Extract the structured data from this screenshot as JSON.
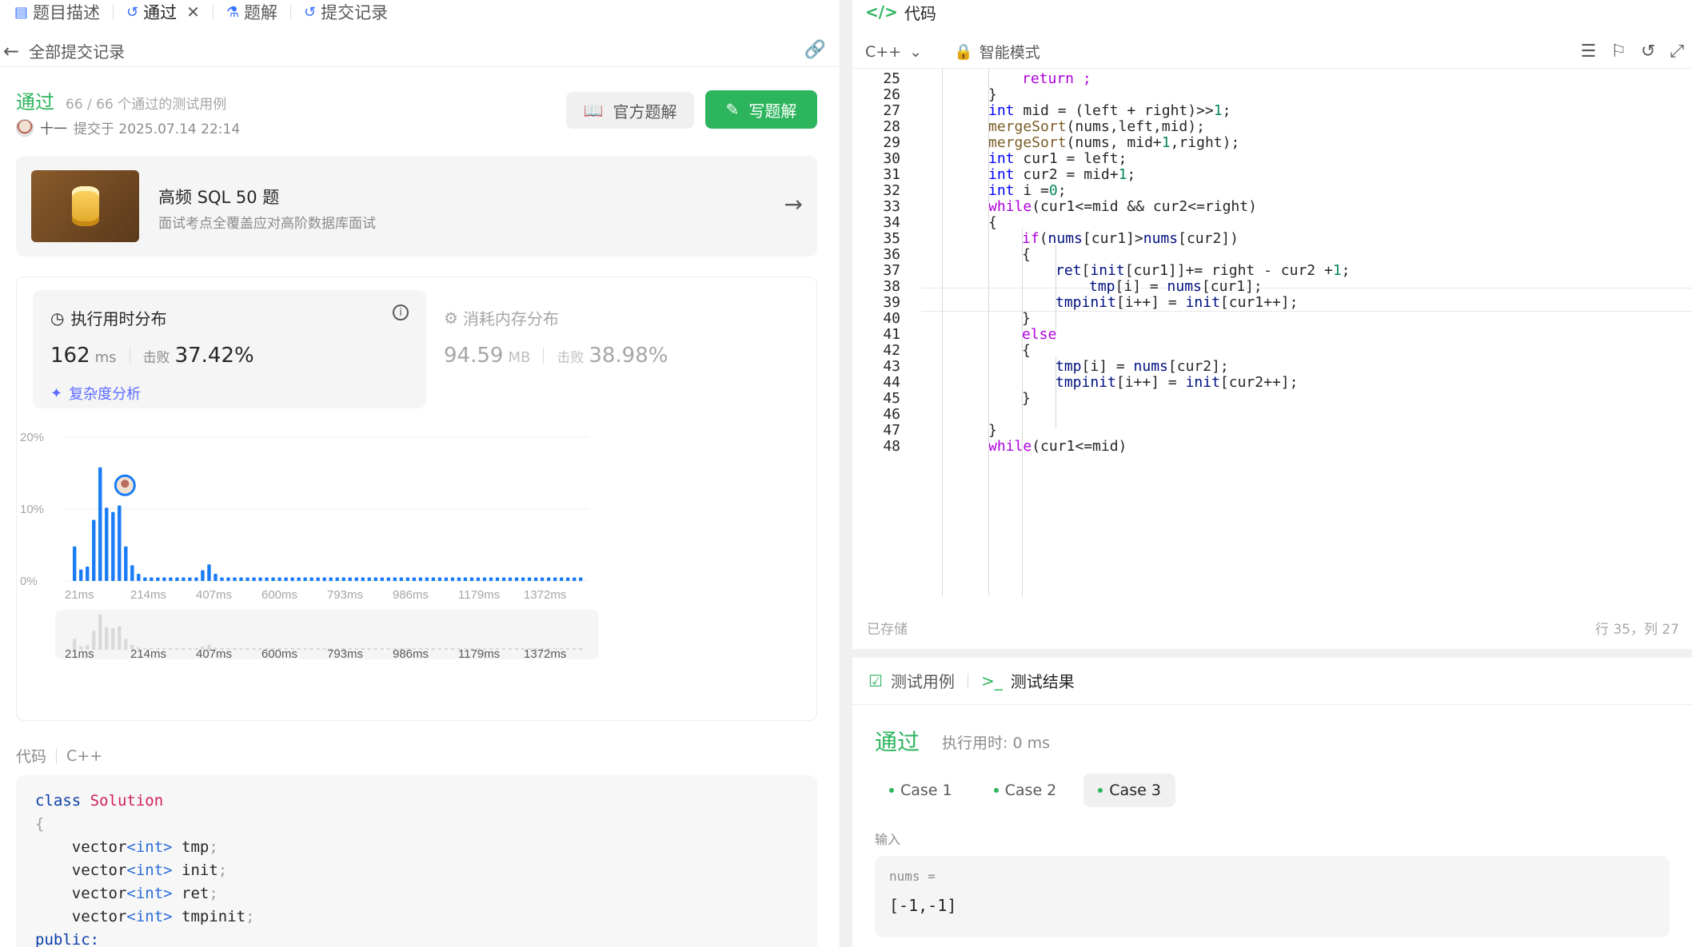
{
  "left": {
    "tabs": [
      {
        "label": "题目描述",
        "icon": "doc-icon"
      },
      {
        "label": "通过",
        "icon": "history-icon"
      },
      {
        "label": "题解",
        "icon": "flask-icon"
      },
      {
        "label": "提交记录",
        "icon": "history-icon"
      }
    ],
    "back_label": "全部提交记录",
    "status": "通过",
    "status_count": "66 / 66 个通过的测试用例",
    "submitter": "十一",
    "submitted_at": "提交于 2025.07.14 22:14",
    "btn_official": "官方题解",
    "btn_write": "写题解",
    "promo_title": "高频 SQL 50 题",
    "promo_sub": "面试考点全覆盖应对高阶数据库面试",
    "runtime_label": "执行用时分布",
    "runtime_value": "162",
    "runtime_unit": "ms",
    "beat_label": "击败",
    "runtime_beat": "37.42%",
    "complexity_label": "复杂度分析",
    "memory_label": "消耗内存分布",
    "memory_value": "94.59",
    "memory_unit": "MB",
    "memory_beat": "38.98%",
    "code_label": "代码",
    "code_lang": "C++",
    "accent_green": "#2db55d",
    "accent_blue": "#1a7cf5"
  },
  "chart_data": {
    "type": "bar",
    "ylim": [
      0,
      20
    ],
    "yticks": [
      "20%",
      "10%",
      "0%"
    ],
    "xticks": [
      "21ms",
      "214ms",
      "407ms",
      "600ms",
      "793ms",
      "986ms",
      "1179ms",
      "1372ms"
    ],
    "values": [
      4.8,
      1.6,
      2.0,
      8.5,
      15.8,
      10.2,
      9.6,
      10.5,
      4.8,
      2.2,
      1.0,
      0.5,
      0.5,
      0.5,
      0.5,
      0.5,
      0.5,
      0.5,
      0.5,
      0.5,
      1.5,
      2.3,
      1.0,
      0.5,
      0.5,
      0.5,
      0.5,
      0.5,
      0.5,
      0.5,
      0.5,
      0.5,
      0.5,
      0.5,
      0.5,
      0.5,
      0.5,
      0.5,
      0.5,
      0.5,
      0.5,
      0.5,
      0.5,
      0.5,
      0.5,
      0.5,
      0.5,
      0.5,
      0.5,
      0.5,
      0.5,
      0.5,
      0.5,
      0.5,
      0.5,
      0.5,
      0.5,
      0.5,
      0.5,
      0.5,
      0.5,
      0.5,
      0.5,
      0.5,
      0.5,
      0.5,
      0.5,
      0.5,
      0.5,
      0.5,
      0.5,
      0.5,
      0.5,
      0.5,
      0.5,
      0.5,
      0.5,
      0.5,
      0.5,
      0.5
    ],
    "marker_index": 7,
    "color": "#1a7cf5"
  },
  "code_preview": [
    [
      {
        "t": "class ",
        "c": "kw"
      },
      {
        "t": "Solution",
        "c": "cls"
      }
    ],
    [
      {
        "t": "{",
        "c": "pc"
      }
    ],
    [
      {
        "t": "    vector",
        "c": ""
      },
      {
        "t": "<int>",
        "c": "ty"
      },
      {
        "t": " tmp",
        "c": ""
      },
      {
        "t": ";",
        "c": "pc"
      }
    ],
    [
      {
        "t": "    vector",
        "c": ""
      },
      {
        "t": "<int>",
        "c": "ty"
      },
      {
        "t": " init",
        "c": ""
      },
      {
        "t": ";",
        "c": "pc"
      }
    ],
    [
      {
        "t": "    vector",
        "c": ""
      },
      {
        "t": "<int>",
        "c": "ty"
      },
      {
        "t": " ret",
        "c": ""
      },
      {
        "t": ";",
        "c": "pc"
      }
    ],
    [
      {
        "t": "    vector",
        "c": ""
      },
      {
        "t": "<int>",
        "c": "ty"
      },
      {
        "t": " tmpinit",
        "c": ""
      },
      {
        "t": ";",
        "c": "pc"
      }
    ],
    [
      {
        "t": "public:",
        "c": "kw"
      }
    ]
  ],
  "editor": {
    "tab_label": "代码",
    "lang": "C++",
    "mode": "智能模式",
    "saved": "已存储",
    "position": "行 35，列 27",
    "lines": [
      {
        "n": "25",
        "indent": 2,
        "parts": [
          {
            "t": "return ;",
            "c": "kp"
          }
        ]
      },
      {
        "n": "26",
        "indent": 1,
        "parts": [
          {
            "t": "}",
            "c": ""
          }
        ]
      },
      {
        "n": "27",
        "indent": 1,
        "parts": [
          {
            "t": "int",
            "c": "kb"
          },
          {
            "t": " mid = (left + right)>>",
            "c": ""
          },
          {
            "t": "1",
            "c": "num"
          },
          {
            "t": ";",
            "c": ""
          }
        ]
      },
      {
        "n": "28",
        "indent": 1,
        "parts": [
          {
            "t": "mergeSort",
            "c": "fn"
          },
          {
            "t": "(nums,left,mid);",
            "c": ""
          }
        ]
      },
      {
        "n": "29",
        "indent": 1,
        "parts": [
          {
            "t": "mergeSort",
            "c": "fn"
          },
          {
            "t": "(nums, mid+",
            "c": ""
          },
          {
            "t": "1",
            "c": "num"
          },
          {
            "t": ",right);",
            "c": ""
          }
        ]
      },
      {
        "n": "30",
        "indent": 1,
        "parts": [
          {
            "t": "int",
            "c": "kb"
          },
          {
            "t": " cur1 = left;",
            "c": ""
          }
        ]
      },
      {
        "n": "31",
        "indent": 1,
        "parts": [
          {
            "t": "int",
            "c": "kb"
          },
          {
            "t": " cur2 = mid+",
            "c": ""
          },
          {
            "t": "1",
            "c": "num"
          },
          {
            "t": ";",
            "c": ""
          }
        ]
      },
      {
        "n": "32",
        "indent": 1,
        "parts": [
          {
            "t": "int",
            "c": "kb"
          },
          {
            "t": " i =",
            "c": ""
          },
          {
            "t": "0",
            "c": "num"
          },
          {
            "t": ";",
            "c": ""
          }
        ]
      },
      {
        "n": "33",
        "indent": 1,
        "parts": [
          {
            "t": "while",
            "c": "kp"
          },
          {
            "t": "(cur1<=mid && cur2<=right)",
            "c": ""
          }
        ]
      },
      {
        "n": "34",
        "indent": 1,
        "parts": [
          {
            "t": "{",
            "c": ""
          }
        ]
      },
      {
        "n": "35",
        "indent": 2,
        "parts": [
          {
            "t": "if",
            "c": "kp"
          },
          {
            "t": "(",
            "c": ""
          },
          {
            "t": "nums",
            "c": "vr"
          },
          {
            "t": "[cur1]>",
            "c": ""
          },
          {
            "t": "nums",
            "c": "vr"
          },
          {
            "t": "[cur2])",
            "c": ""
          }
        ]
      },
      {
        "n": "36",
        "indent": 2,
        "parts": [
          {
            "t": "{",
            "c": ""
          }
        ]
      },
      {
        "n": "37",
        "indent": 3,
        "parts": [
          {
            "t": "ret",
            "c": "vr"
          },
          {
            "t": "[",
            "c": ""
          },
          {
            "t": "init",
            "c": "vr"
          },
          {
            "t": "[cur1]]+= right - cur2 +",
            "c": ""
          },
          {
            "t": "1",
            "c": "num"
          },
          {
            "t": ";",
            "c": ""
          }
        ]
      },
      {
        "n": "38",
        "indent": 4,
        "parts": [
          {
            "t": "tmp",
            "c": "vr"
          },
          {
            "t": "[i] = ",
            "c": ""
          },
          {
            "t": "nums",
            "c": "vr"
          },
          {
            "t": "[cur1];",
            "c": ""
          }
        ]
      },
      {
        "n": "39",
        "indent": 3,
        "parts": [
          {
            "t": "tmpinit",
            "c": "vr"
          },
          {
            "t": "[i++] = ",
            "c": ""
          },
          {
            "t": "init",
            "c": "vr"
          },
          {
            "t": "[cur1++];",
            "c": ""
          }
        ]
      },
      {
        "n": "40",
        "indent": 2,
        "parts": [
          {
            "t": "}",
            "c": ""
          }
        ]
      },
      {
        "n": "41",
        "indent": 2,
        "parts": [
          {
            "t": "else",
            "c": "kp"
          }
        ]
      },
      {
        "n": "42",
        "indent": 2,
        "parts": [
          {
            "t": "{",
            "c": ""
          }
        ]
      },
      {
        "n": "43",
        "indent": 3,
        "parts": [
          {
            "t": "tmp",
            "c": "vr"
          },
          {
            "t": "[i] = ",
            "c": ""
          },
          {
            "t": "nums",
            "c": "vr"
          },
          {
            "t": "[cur2];",
            "c": ""
          }
        ]
      },
      {
        "n": "44",
        "indent": 3,
        "parts": [
          {
            "t": "tmpinit",
            "c": "vr"
          },
          {
            "t": "[i++] = ",
            "c": ""
          },
          {
            "t": "init",
            "c": "vr"
          },
          {
            "t": "[cur2++];",
            "c": ""
          }
        ]
      },
      {
        "n": "45",
        "indent": 2,
        "parts": [
          {
            "t": "}",
            "c": ""
          }
        ]
      },
      {
        "n": "46",
        "indent": 1,
        "parts": []
      },
      {
        "n": "47",
        "indent": 1,
        "parts": [
          {
            "t": "}",
            "c": ""
          }
        ]
      },
      {
        "n": "48",
        "indent": 1,
        "parts": [
          {
            "t": "while",
            "c": "kp"
          },
          {
            "t": "(cur1<=mid)",
            "c": ""
          }
        ]
      }
    ]
  },
  "result": {
    "tab_testcase": "测试用例",
    "tab_result": "测试结果",
    "status": "通过",
    "runtime": "执行用时: 0 ms",
    "cases": [
      "Case 1",
      "Case 2",
      "Case 3"
    ],
    "selected_case": 2,
    "input_label": "输入",
    "input_name": "nums =",
    "input_value": "[-1,-1]"
  }
}
